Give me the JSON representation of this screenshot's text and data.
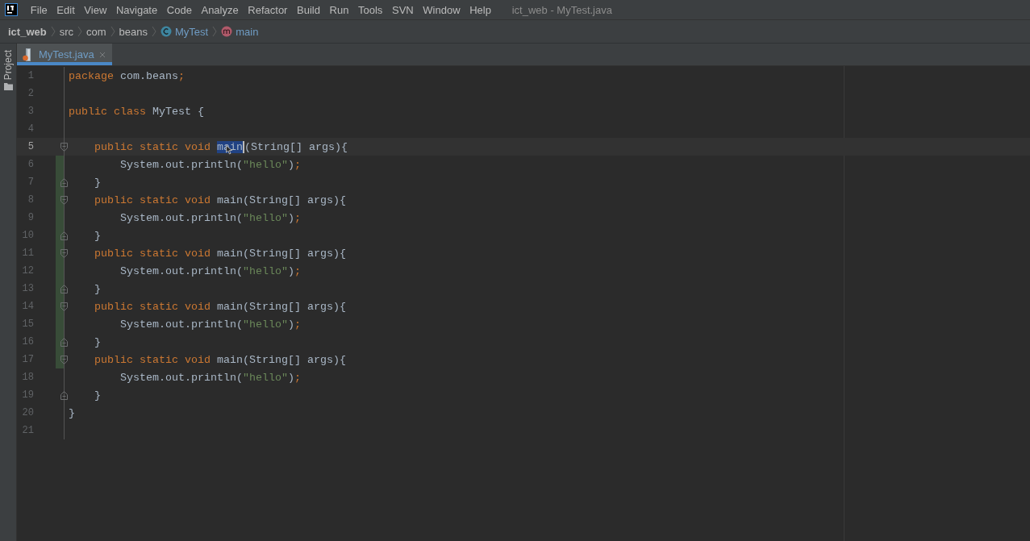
{
  "menu_bar": {
    "items": [
      "File",
      "Edit",
      "View",
      "Navigate",
      "Code",
      "Analyze",
      "Refactor",
      "Build",
      "Run",
      "Tools",
      "SVN",
      "Window",
      "Help"
    ],
    "title": "ict_web - MyTest.java"
  },
  "breadcrumbs": [
    {
      "label": "ict_web",
      "kind": "project"
    },
    {
      "label": "src",
      "kind": "folder"
    },
    {
      "label": "com",
      "kind": "folder"
    },
    {
      "label": "beans",
      "kind": "folder"
    },
    {
      "label": "MyTest",
      "kind": "class"
    },
    {
      "label": "main",
      "kind": "method"
    }
  ],
  "tool_stripe": {
    "label": "Project"
  },
  "tabs": [
    {
      "label": "MyTest.java",
      "selected": true,
      "closable": true
    }
  ],
  "editor": {
    "lines": [
      {
        "number": "1",
        "fold_start": false,
        "fold_end": false,
        "changed": false,
        "current": false,
        "tokens": [
          {
            "text": "package",
            "kind": "keyword"
          },
          {
            "text": " com.beans",
            "kind": "plain"
          },
          {
            "text": ";",
            "kind": "keyword"
          }
        ]
      },
      {
        "number": "2",
        "fold_start": false,
        "fold_end": false,
        "changed": false,
        "current": false
      },
      {
        "number": "3",
        "fold_start": false,
        "fold_end": false,
        "changed": false,
        "current": false,
        "tokens": [
          {
            "text": "public class",
            "kind": "keyword"
          },
          {
            "text": " MyTest {",
            "kind": "plain"
          }
        ]
      },
      {
        "number": "4",
        "fold_start": false,
        "fold_end": false,
        "changed": false,
        "current": false
      },
      {
        "number": "5",
        "fold_start": true,
        "fold_end": false,
        "changed": false,
        "current": true,
        "tokens": [
          {
            "text": "    public static void ",
            "kind": "keyword"
          },
          {
            "text": "main",
            "kind": "plain",
            "selected": true
          },
          {
            "text": "(String[] args){",
            "kind": "plain"
          }
        ]
      },
      {
        "number": "6",
        "fold_start": false,
        "fold_end": false,
        "changed": true,
        "current": false,
        "tokens": [
          {
            "text": "        System.out.println(",
            "kind": "plain"
          },
          {
            "text": "\"hello\"",
            "kind": "string"
          },
          {
            "text": ")",
            "kind": "plain"
          },
          {
            "text": ";",
            "kind": "keyword"
          }
        ]
      },
      {
        "number": "7",
        "fold_start": false,
        "fold_end": true,
        "changed": true,
        "current": false,
        "tokens": [
          {
            "text": "    }",
            "kind": "plain"
          }
        ]
      },
      {
        "number": "8",
        "fold_start": true,
        "fold_end": false,
        "changed": true,
        "current": false,
        "tokens": [
          {
            "text": "    public static void",
            "kind": "keyword"
          },
          {
            "text": " main(String[] args){",
            "kind": "plain"
          }
        ]
      },
      {
        "number": "9",
        "fold_start": false,
        "fold_end": false,
        "changed": true,
        "current": false,
        "tokens": [
          {
            "text": "        System.out.println(",
            "kind": "plain"
          },
          {
            "text": "\"hello\"",
            "kind": "string"
          },
          {
            "text": ")",
            "kind": "plain"
          },
          {
            "text": ";",
            "kind": "keyword"
          }
        ]
      },
      {
        "number": "10",
        "fold_start": false,
        "fold_end": true,
        "changed": true,
        "current": false,
        "tokens": [
          {
            "text": "    }",
            "kind": "plain"
          }
        ]
      },
      {
        "number": "11",
        "fold_start": true,
        "fold_end": false,
        "changed": true,
        "current": false,
        "tokens": [
          {
            "text": "    public static void",
            "kind": "keyword"
          },
          {
            "text": " main(String[] args){",
            "kind": "plain"
          }
        ]
      },
      {
        "number": "12",
        "fold_start": false,
        "fold_end": false,
        "changed": true,
        "current": false,
        "tokens": [
          {
            "text": "        System.out.println(",
            "kind": "plain"
          },
          {
            "text": "\"hello\"",
            "kind": "string"
          },
          {
            "text": ")",
            "kind": "plain"
          },
          {
            "text": ";",
            "kind": "keyword"
          }
        ]
      },
      {
        "number": "13",
        "fold_start": false,
        "fold_end": true,
        "changed": true,
        "current": false,
        "tokens": [
          {
            "text": "    }",
            "kind": "plain"
          }
        ]
      },
      {
        "number": "14",
        "fold_start": true,
        "fold_end": false,
        "changed": true,
        "current": false,
        "tokens": [
          {
            "text": "    public static void",
            "kind": "keyword"
          },
          {
            "text": " main(String[] args){",
            "kind": "plain"
          }
        ]
      },
      {
        "number": "15",
        "fold_start": false,
        "fold_end": false,
        "changed": true,
        "current": false,
        "tokens": [
          {
            "text": "        System.out.println(",
            "kind": "plain"
          },
          {
            "text": "\"hello\"",
            "kind": "string"
          },
          {
            "text": ")",
            "kind": "plain"
          },
          {
            "text": ";",
            "kind": "keyword"
          }
        ]
      },
      {
        "number": "16",
        "fold_start": false,
        "fold_end": true,
        "changed": true,
        "current": false,
        "tokens": [
          {
            "text": "    }",
            "kind": "plain"
          }
        ]
      },
      {
        "number": "17",
        "fold_start": true,
        "fold_end": false,
        "changed": true,
        "current": false,
        "tokens": [
          {
            "text": "    public static void",
            "kind": "keyword"
          },
          {
            "text": " main(String[] args){",
            "kind": "plain"
          }
        ]
      },
      {
        "number": "18",
        "fold_start": false,
        "fold_end": false,
        "changed": false,
        "current": false,
        "tokens": [
          {
            "text": "        System.out.println(",
            "kind": "plain"
          },
          {
            "text": "\"hello\"",
            "kind": "string"
          },
          {
            "text": ")",
            "kind": "plain"
          },
          {
            "text": ";",
            "kind": "keyword"
          }
        ]
      },
      {
        "number": "19",
        "fold_start": false,
        "fold_end": true,
        "changed": false,
        "current": false,
        "tokens": [
          {
            "text": "    }",
            "kind": "plain"
          }
        ]
      },
      {
        "number": "20",
        "fold_start": false,
        "fold_end": false,
        "changed": false,
        "current": false,
        "tokens": [
          {
            "text": "}",
            "kind": "plain"
          }
        ]
      },
      {
        "number": "21",
        "fold_start": false,
        "fold_end": false,
        "changed": false,
        "current": false
      }
    ]
  }
}
